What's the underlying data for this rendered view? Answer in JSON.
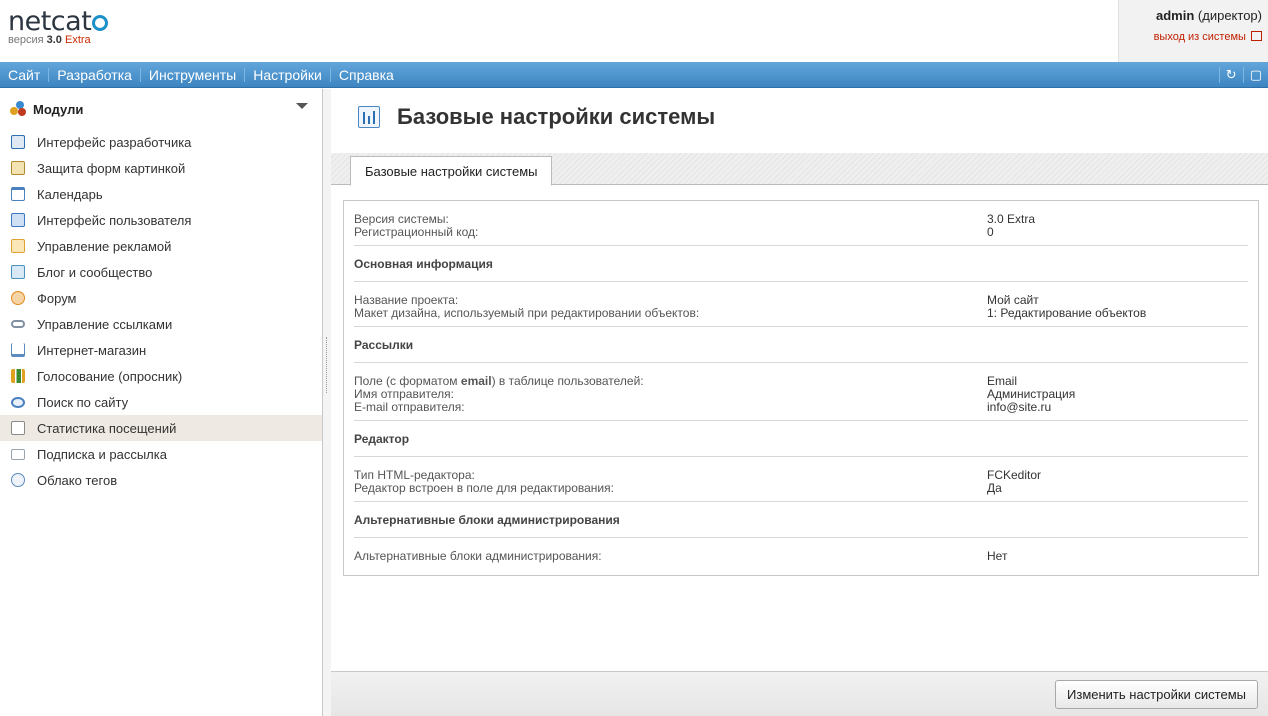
{
  "header": {
    "logo_text": "netcat",
    "version_prefix": "версия",
    "version_number": "3.0",
    "version_edition": "Extra",
    "user_name": "admin",
    "user_role": "(директор)",
    "logout_label": "выход из системы"
  },
  "topnav": {
    "items": [
      {
        "label": "Сайт"
      },
      {
        "label": "Разработка"
      },
      {
        "label": "Инструменты"
      },
      {
        "label": "Настройки"
      },
      {
        "label": "Справка"
      }
    ]
  },
  "sidebar": {
    "title": "Модули",
    "items": [
      {
        "label": "Интерфейс разработчика",
        "icon": "wrench-icon",
        "color": "#2f6fb3"
      },
      {
        "label": "Защита форм картинкой",
        "icon": "captcha-icon",
        "color": "#d0a020"
      },
      {
        "label": "Календарь",
        "icon": "calendar-icon",
        "color": "#4a7fc0"
      },
      {
        "label": "Интерфейс пользователя",
        "icon": "user-icon",
        "color": "#3b78c2"
      },
      {
        "label": "Управление рекламой",
        "icon": "ad-icon",
        "color": "#e0a030"
      },
      {
        "label": "Блог и сообщество",
        "icon": "blog-icon",
        "color": "#4a90c0"
      },
      {
        "label": "Форум",
        "icon": "forum-icon",
        "color": "#e08a20"
      },
      {
        "label": "Управление ссылками",
        "icon": "link-icon",
        "color": "#8090a0"
      },
      {
        "label": "Интернет-магазин",
        "icon": "cart-icon",
        "color": "#5a8ac0"
      },
      {
        "label": "Голосование (опросник)",
        "icon": "poll-icon",
        "color": "#e0a020"
      },
      {
        "label": "Поиск по сайту",
        "icon": "search-icon",
        "color": "#4a7fc0"
      },
      {
        "label": "Статистика посещений",
        "icon": "stats-icon",
        "color": "#8a8a8a"
      },
      {
        "label": "Подписка и рассылка",
        "icon": "mail-icon",
        "color": "#9aa4ae"
      },
      {
        "label": "Облако тегов",
        "icon": "tag-cloud-icon",
        "color": "#5a8ac0"
      }
    ],
    "active_index": 11
  },
  "main": {
    "title": "Базовые настройки системы",
    "tab_label": "Базовые настройки системы",
    "rows": {
      "r1_l1": "Версия системы:",
      "r1_l2": "Регистрационный код:",
      "r1_v1": "3.0 Extra",
      "r1_v2": "0",
      "s1": "Основная информация",
      "r2_l1": "Название проекта:",
      "r2_l2": "Макет дизайна, используемый при редактировании объектов:",
      "r2_v1": "Мой сайт",
      "r2_v2": "1: Редактирование объектов",
      "s2": "Рассылки",
      "r3_l1a": "Поле (с форматом",
      "r3_l1b": "email",
      "r3_l1c": ") в таблице пользователей:",
      "r3_l2": "Имя отправителя:",
      "r3_l3": "E-mail отправителя:",
      "r3_v1": "Email",
      "r3_v2": "Администрация",
      "r3_v3": "info@site.ru",
      "s3": "Редактор",
      "r4_l1": "Тип HTML-редактора:",
      "r4_l2": "Редактор встроен в поле для редактирования:",
      "r4_v1": "FCKeditor",
      "r4_v2": "Да",
      "s4": "Альтернативные блоки администрирования",
      "r5_l1": "Альтернативные блоки администрирования:",
      "r5_v1": "Нет"
    },
    "save_button": "Изменить настройки системы"
  },
  "colors": {
    "nav_bar": "#4a93cf",
    "active_item_bg": "#eee9e2",
    "brand_red": "#cc2a00"
  }
}
